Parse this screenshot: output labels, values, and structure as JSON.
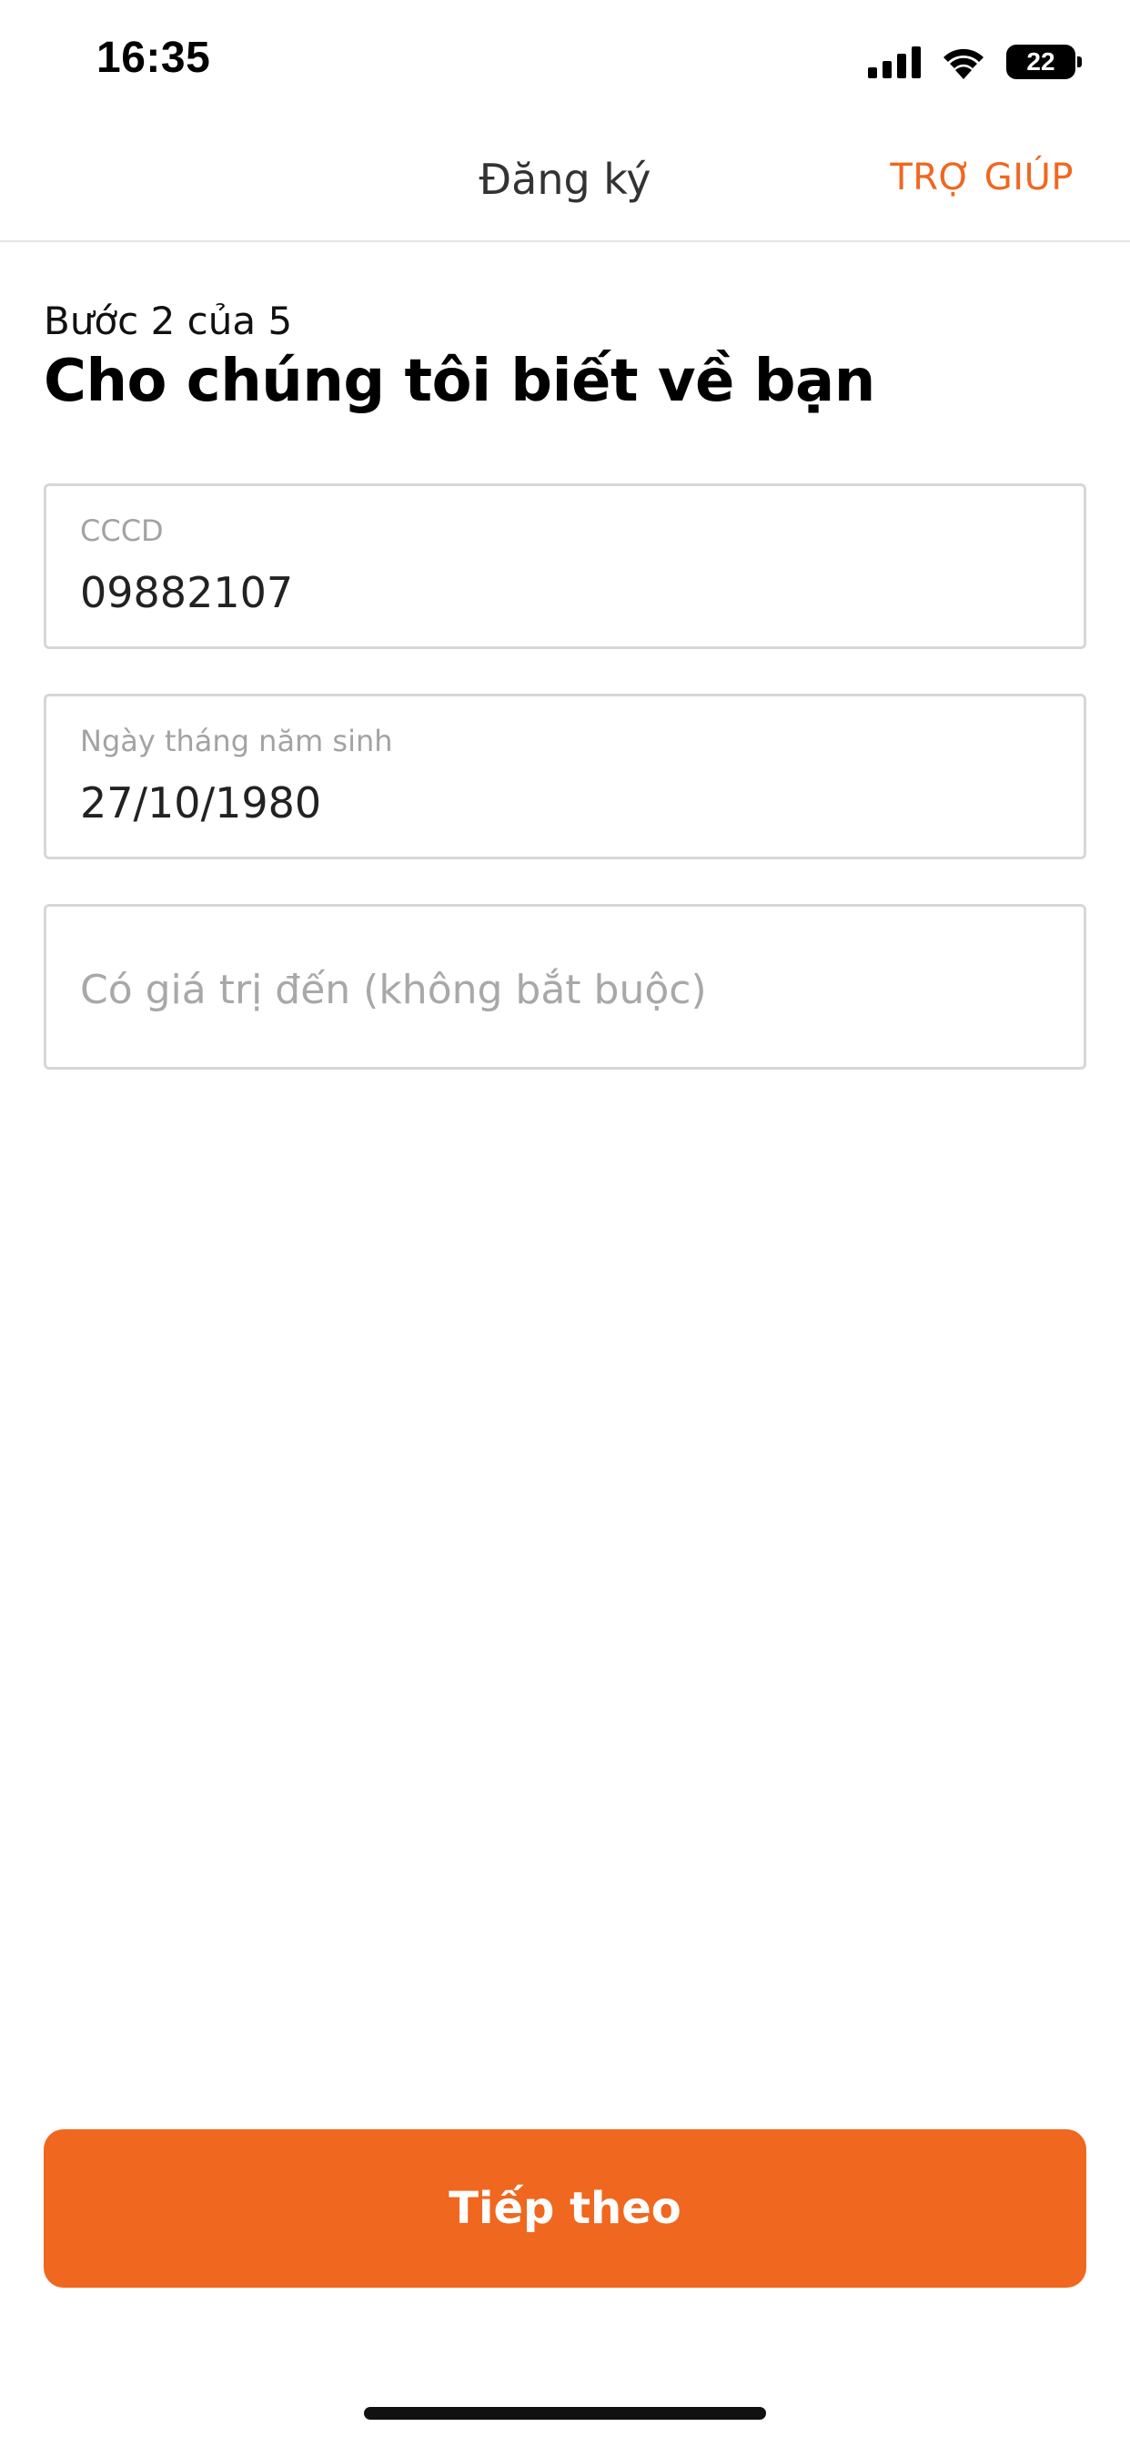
{
  "status_bar": {
    "time": "16:35",
    "battery": "22",
    "icons": [
      "signal-icon",
      "wifi-icon",
      "battery-icon"
    ]
  },
  "nav": {
    "title": "Đăng ký",
    "help_label": "TRỢ GIÚP"
  },
  "header": {
    "step": "Bước 2 của 5",
    "title": "Cho chúng tôi biết về bạn"
  },
  "form": {
    "id_field": {
      "label": "CCCD",
      "value": "09882107"
    },
    "dob_field": {
      "label": "Ngày tháng năm sinh",
      "value": "27/10/1980"
    },
    "expiry_field": {
      "placeholder": "Có giá trị đến (không bắt buộc)"
    }
  },
  "actions": {
    "next_label": "Tiếp theo"
  },
  "colors": {
    "accent": "#f0671f",
    "border": "#d7d7d7",
    "placeholder": "#a8a8a8"
  }
}
